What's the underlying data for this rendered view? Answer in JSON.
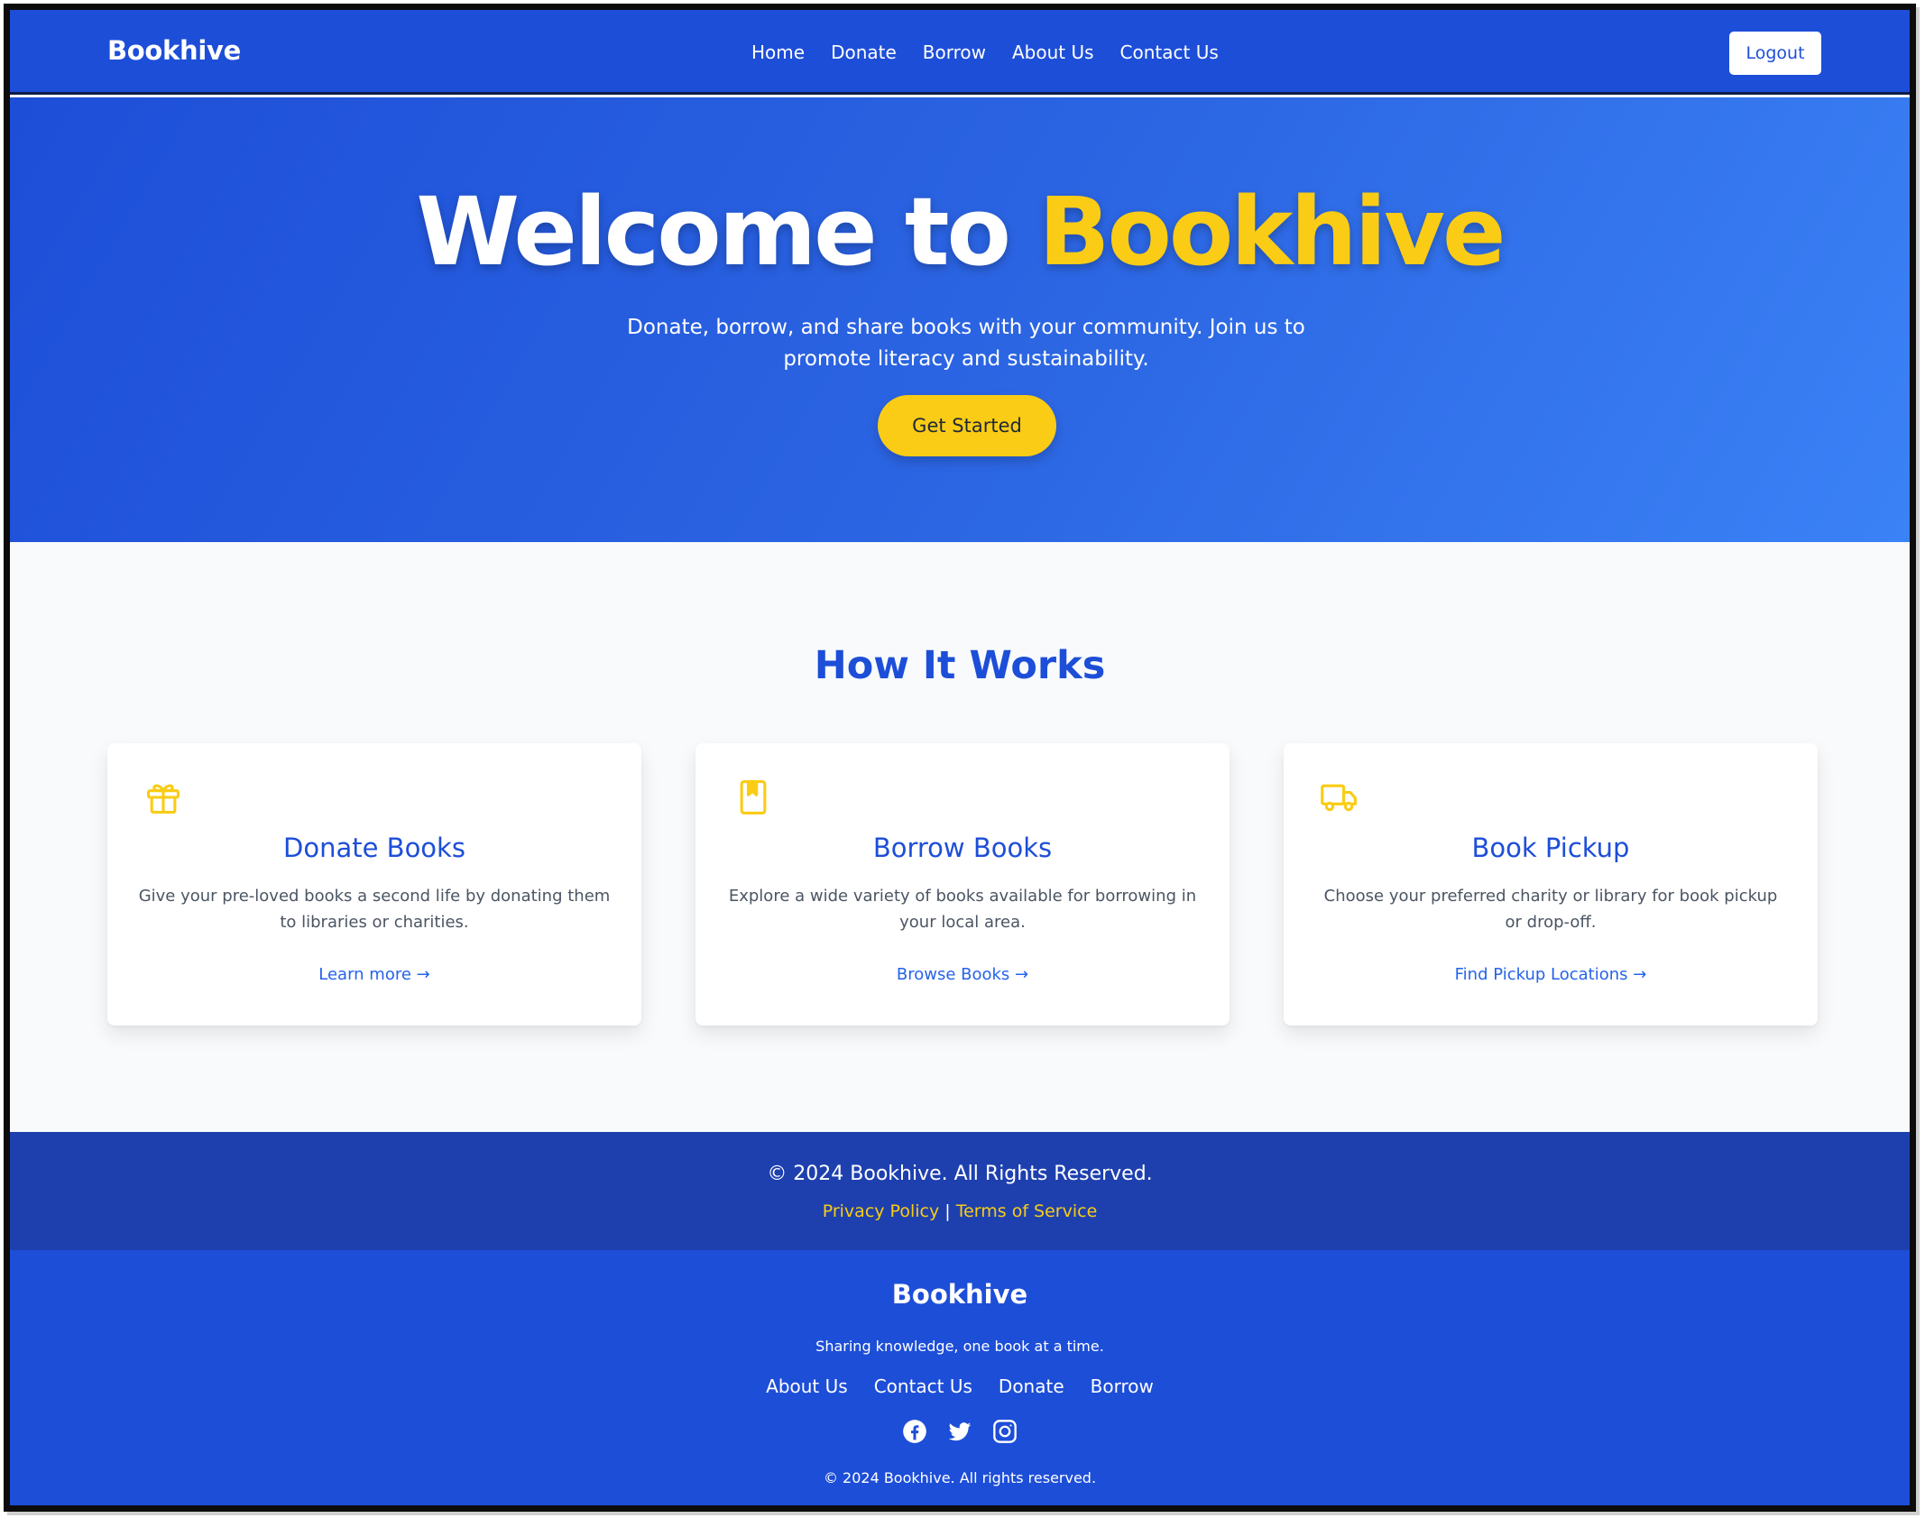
{
  "nav": {
    "brand": "Bookhive",
    "links": [
      "Home",
      "Donate",
      "Borrow",
      "About Us",
      "Contact Us"
    ],
    "logout_label": "Logout"
  },
  "hero": {
    "title_prefix": "Welcome to ",
    "title_accent": "Bookhive",
    "subtitle": "Donate, borrow, and share books with your community. Join us to promote literacy and sustainability.",
    "cta_label": "Get Started"
  },
  "how_it_works": {
    "title": "How It Works",
    "cards": [
      {
        "icon": "gift-icon",
        "title": "Donate Books",
        "description": "Give your pre-loved books a second life by donating them to libraries or charities.",
        "link": "Learn more →"
      },
      {
        "icon": "book-icon",
        "title": "Borrow Books",
        "description": "Explore a wide variety of books available for borrowing in your local area.",
        "link": "Browse Books →"
      },
      {
        "icon": "truck-icon",
        "title": "Book Pickup",
        "description": "Choose your preferred charity or library for book pickup or drop-off.",
        "link": "Find Pickup Locations →"
      }
    ]
  },
  "footer_top": {
    "copyright": "© 2024 Bookhive. All Rights Reserved.",
    "privacy": "Privacy Policy",
    "separator": "|",
    "terms": "Terms of Service"
  },
  "footer_bottom": {
    "brand": "Bookhive",
    "tagline": "Sharing knowledge, one book at a time.",
    "links": [
      "About Us",
      "Contact Us",
      "Donate",
      "Borrow"
    ],
    "socials": [
      "facebook-icon",
      "twitter-icon",
      "instagram-icon"
    ],
    "copyright": "© 2024 Bookhive. All rights reserved."
  },
  "colors": {
    "primary": "#1d4ed8",
    "accent": "#facc15",
    "footer_dark": "#1e40af"
  }
}
